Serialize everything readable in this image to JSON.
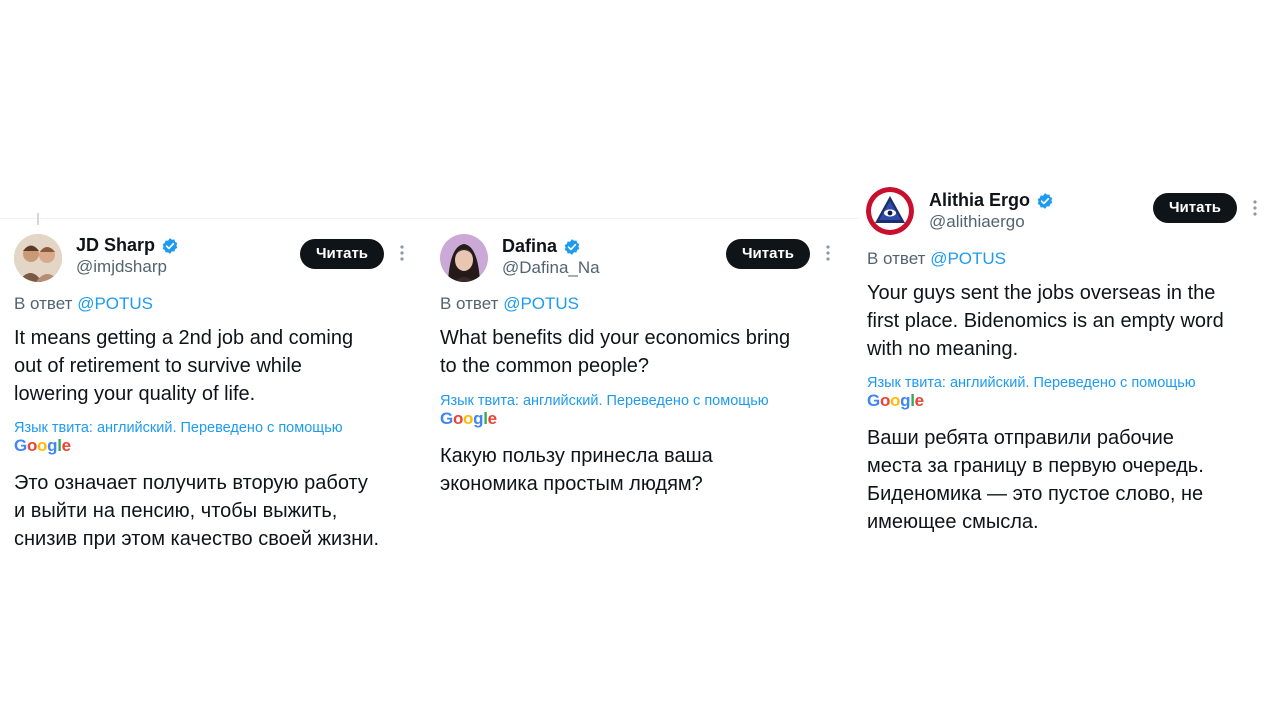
{
  "tweets": [
    {
      "name": "JD Sharp",
      "handle": "@imjdsharp",
      "follow_label": "Читать",
      "reply_prefix": "В ответ",
      "reply_to": "@POTUS",
      "text_lines": [
        "It means getting a 2nd job and coming",
        "out of retirement to survive while",
        "lowering your quality of life."
      ],
      "translation_note": "Язык твита: английский. Переведено с помощью",
      "translation_lines": [
        "Это означает получить вторую работу",
        "и выйти на пенсию, чтобы выжить,",
        "снизив при этом качество своей жизни."
      ]
    },
    {
      "name": "Dafina",
      "handle": "@Dafina_Na",
      "follow_label": "Читать",
      "reply_prefix": "В ответ",
      "reply_to": "@POTUS",
      "text_lines": [
        "What benefits did your economics bring",
        "to the common people?"
      ],
      "translation_note": "Язык твита: английский. Переведено с помощью",
      "translation_lines": [
        "Какую пользу принесла ваша",
        "экономика простым людям?"
      ]
    },
    {
      "name": "Alithia Ergo",
      "handle": "@alithiaergo",
      "follow_label": "Читать",
      "reply_prefix": "В ответ",
      "reply_to": "@POTUS",
      "text_lines": [
        "Your guys sent the jobs overseas in the",
        "first place. Bidenomics is an empty word",
        "with no meaning."
      ],
      "translation_note": "Язык твита: английский. Переведено с помощью",
      "translation_lines": [
        "Ваши ребята отправили рабочие",
        "места за границу в первую очередь.",
        "Биденомика — это пустое слово, не",
        "имеющее смысла."
      ]
    }
  ],
  "google_logo": "Google",
  "icons": {
    "verified": "verified-badge-icon",
    "more": "more-options-icon"
  },
  "colors": {
    "link": "#1d9bf0",
    "secondary_text": "#536471",
    "button_bg": "#0f1419"
  }
}
